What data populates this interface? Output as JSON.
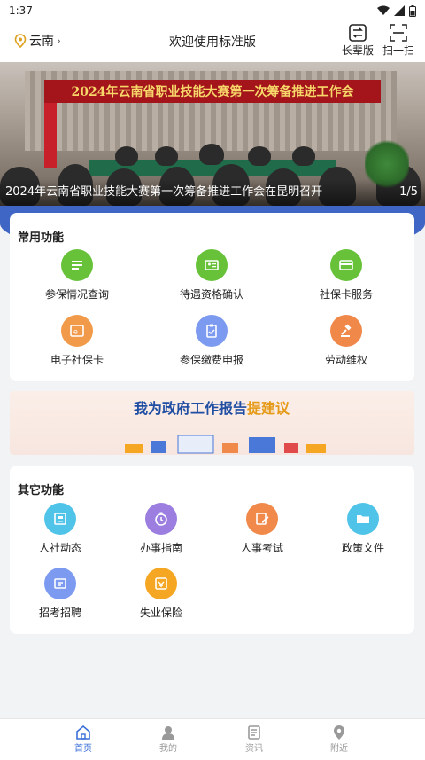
{
  "status_bar": {
    "time": "1:37"
  },
  "header": {
    "location": "云南",
    "title": "欢迎使用标准版",
    "elder_label": "长辈版",
    "scan_label": "扫一扫"
  },
  "banner": {
    "headline": "2024年云南省职业技能大赛第一次筹备推进工作会",
    "caption": "2024年云南省职业技能大赛第一次筹备推进工作会在昆明召开",
    "pager": "1/5"
  },
  "common": {
    "title": "常用功能",
    "items": [
      {
        "label": "参保情况查询",
        "icon": "list-icon",
        "color": "#67c23a"
      },
      {
        "label": "待遇资格确认",
        "icon": "id-card-icon",
        "color": "#67c23a"
      },
      {
        "label": "社保卡服务",
        "icon": "card-icon",
        "color": "#67c23a"
      },
      {
        "label": "电子社保卡",
        "icon": "e-card-icon",
        "color": "#f19a4a"
      },
      {
        "label": "参保缴费申报",
        "icon": "clipboard-icon",
        "color": "#7b9af0"
      },
      {
        "label": "劳动维权",
        "icon": "gavel-icon",
        "color": "#f0884a"
      }
    ]
  },
  "ad": {
    "text_main": "我为政府工作报告",
    "text_accent": "提建议"
  },
  "other": {
    "title": "其它功能",
    "items": [
      {
        "label": "人社动态",
        "icon": "news-icon",
        "color": "#4fc3e8"
      },
      {
        "label": "办事指南",
        "icon": "clock-icon",
        "color": "#9b7ee0"
      },
      {
        "label": "人事考试",
        "icon": "edit-icon",
        "color": "#f0894a"
      },
      {
        "label": "政策文件",
        "icon": "folder-icon",
        "color": "#4fc3e8"
      },
      {
        "label": "招考招聘",
        "icon": "recruit-icon",
        "color": "#7b9af0"
      },
      {
        "label": "失业保险",
        "icon": "insurance-icon",
        "color": "#f5a623"
      }
    ]
  },
  "tabbar": {
    "items": [
      {
        "label": "首页",
        "icon": "home-icon"
      },
      {
        "label": "我的",
        "icon": "user-icon"
      },
      {
        "label": "资讯",
        "icon": "news-tab-icon"
      },
      {
        "label": "附近",
        "icon": "location-icon"
      }
    ]
  }
}
